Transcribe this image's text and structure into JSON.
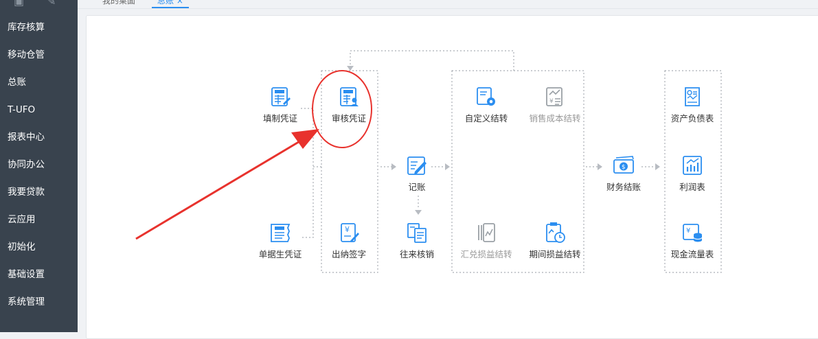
{
  "sidebar": {
    "top_icons": [
      "clipboard-icon",
      "edit-icon"
    ],
    "items": [
      {
        "label": "库存核算"
      },
      {
        "label": "移动仓管"
      },
      {
        "label": "总账"
      },
      {
        "label": "T-UFO"
      },
      {
        "label": "报表中心"
      },
      {
        "label": "协同办公"
      },
      {
        "label": "我要贷款"
      },
      {
        "label": "云应用"
      },
      {
        "label": "初始化"
      },
      {
        "label": "基础设置"
      },
      {
        "label": "系统管理"
      }
    ]
  },
  "tabs": [
    {
      "label": "我的桌面"
    },
    {
      "label": "总账 ×"
    }
  ],
  "flow": {
    "fill_voucher": "填制凭证",
    "audit_voucher": "审核凭证",
    "document_voucher": "单据生凭证",
    "cashier_sign": "出纳签字",
    "post": "记账",
    "writeoff": "往来核销",
    "custom_transfer": "自定义结转",
    "sales_cost_transfer": "销售成本结转",
    "fx_transfer": "汇兑损益结转",
    "period_pl_transfer": "期间损益结转",
    "closing": "财务结账",
    "balance_sheet": "资产负债表",
    "income_statement": "利润表",
    "cash_flow": "现金流量表"
  },
  "colors": {
    "sidebar_bg": "#39434e",
    "icon_blue": "#2b8ef0",
    "icon_dim": "#9aa0a6",
    "annotation_red": "#e8322d"
  }
}
